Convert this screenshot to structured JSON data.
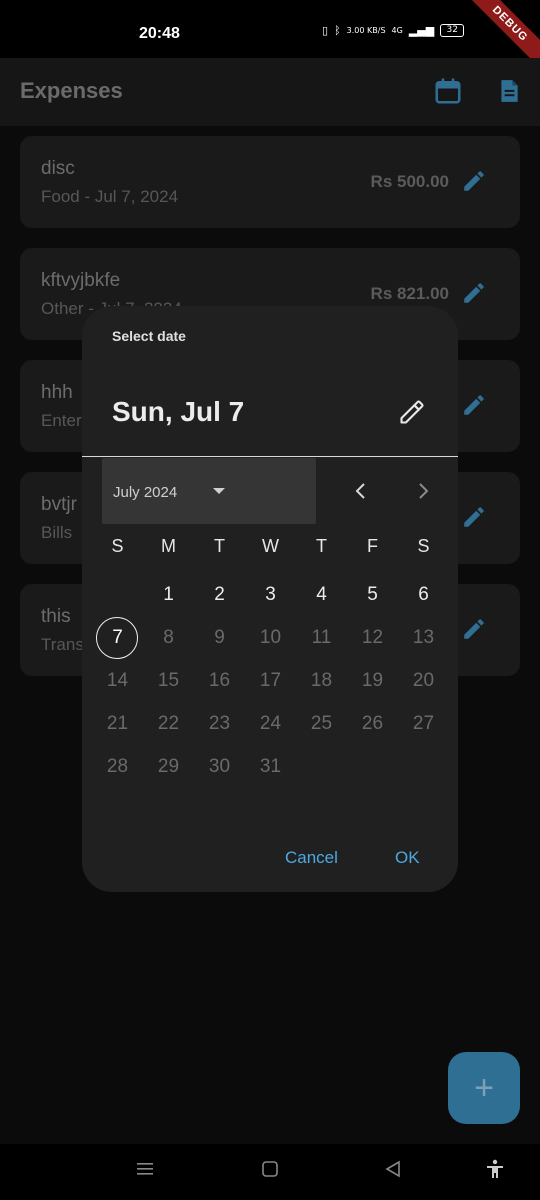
{
  "status_bar": {
    "time": "20:48",
    "network_speed": "3.00 KB/S",
    "net_type": "4G",
    "battery": "32",
    "debug_banner": "DEBUG"
  },
  "app_bar": {
    "title": "Expenses",
    "calendar_icon": "calendar-icon",
    "report_icon": "document-icon"
  },
  "expenses": [
    {
      "name": "disc",
      "meta": "Food - Jul 7, 2024",
      "amount": "Rs 500.00"
    },
    {
      "name": "kftvyjbkfe",
      "meta": "Other - Jul 7, 2024",
      "amount": "Rs 821.00"
    },
    {
      "name": "hhh",
      "meta": "Enter",
      "amount": ""
    },
    {
      "name": "bvtjr",
      "meta": "Bills",
      "amount": ""
    },
    {
      "name": "this",
      "meta": "Trans",
      "amount": ""
    }
  ],
  "fab": {
    "label": "+"
  },
  "date_picker": {
    "help_text": "Select date",
    "headline": "Sun, Jul 7",
    "month_label": "July 2024",
    "weekdays": [
      "S",
      "M",
      "T",
      "W",
      "T",
      "F",
      "S"
    ],
    "days": [
      "1",
      "2",
      "3",
      "4",
      "5",
      "6",
      "7",
      "8",
      "9",
      "10",
      "11",
      "12",
      "13",
      "14",
      "15",
      "16",
      "17",
      "18",
      "19",
      "20",
      "21",
      "22",
      "23",
      "24",
      "25",
      "26",
      "27",
      "28",
      "29",
      "30",
      "31"
    ],
    "first_weekday_index": 1,
    "selected_day": "7",
    "last_enabled_day": 7,
    "cancel_label": "Cancel",
    "ok_label": "OK"
  },
  "colors": {
    "accent": "#4ea8e0",
    "fab": "#2e6f93",
    "dialog_bg": "#202020",
    "background": "#0b0b0b"
  }
}
